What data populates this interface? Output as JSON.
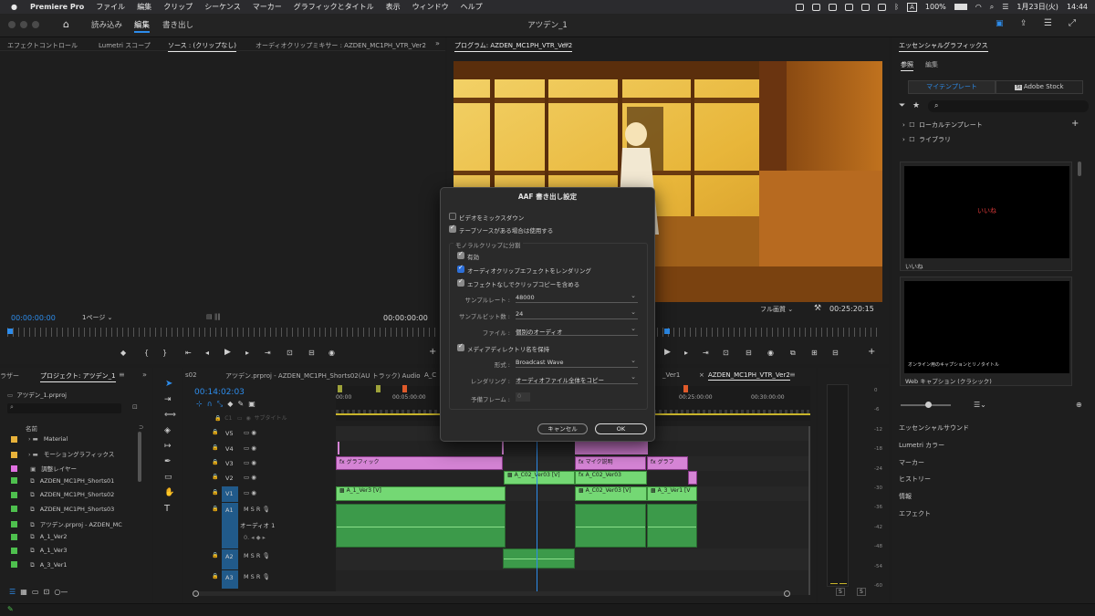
{
  "menubar": {
    "items": [
      "Premiere Pro",
      "ファイル",
      "編集",
      "クリップ",
      "シーケンス",
      "マーカー",
      "グラフィックとタイトル",
      "表示",
      "ウィンドウ",
      "ヘルプ"
    ],
    "battery": "100%",
    "input": "A",
    "datetime": "1月23日(火)",
    "time": "14:44"
  },
  "titlebar": {
    "workspaces": [
      "読み込み",
      "編集",
      "書き出し"
    ],
    "title": "アツデン_1"
  },
  "source_panel": {
    "tabs": [
      "エフェクトコントロール",
      "Lumetri スコープ",
      "ソース : (クリップなし)",
      "オーディオクリップミキサー : AZDEN_MC1PH_VTR_Ver2"
    ],
    "timecode_in": "00:00:00:00",
    "page": "1ページ",
    "timecode_out": "00:00:00:00"
  },
  "program_panel": {
    "title": "プログラム: AZDEN_MC1PH_VTR_Ver2",
    "quality": "フル画質",
    "timecode": "00:25:20:15"
  },
  "dialog": {
    "title": "AAF 書き出し設定",
    "mixdown": "ビデオをミックスダウン",
    "use_tape": "テープソースがある場合は使用する",
    "mono_group": "モノラルクリップに分割",
    "enable": "有効",
    "render_fx": "オーディオクリップエフェクトをレンダリング",
    "include_copy": "エフェクトなしでクリップコピーを含める",
    "sample_rate_label": "サンプルレート :",
    "sample_rate": "48000",
    "bit_depth_label": "サンプルビット数 :",
    "bit_depth": "24",
    "file_label": "ファイル :",
    "file": "個別のオーディオ",
    "keep_names": "メディアディレクトリ名を保持",
    "format_label": "形式 :",
    "format": "Broadcast Wave",
    "rendering_label": "レンダリング :",
    "rendering": "オーディオファイル全体をコピー",
    "preroll_label": "予備フレーム :",
    "preroll": "0",
    "cancel": "キャンセル",
    "ok": "OK"
  },
  "project_panel": {
    "tab_prev": "ラザー",
    "tab": "プロジェクト: アツデン_1",
    "file": "アツデン_1.prproj",
    "name_header": "名前",
    "items": [
      {
        "label": "Material",
        "color": "#e8b23a",
        "type": "folder"
      },
      {
        "label": "モーショングラフィックス",
        "color": "#e8b23a",
        "type": "folder"
      },
      {
        "label": "調整レイヤー",
        "color": "#e070e0",
        "type": "item"
      },
      {
        "label": "AZDEN_MC1PH_Shorts01",
        "color": "#4ec04e",
        "type": "seq"
      },
      {
        "label": "AZDEN_MC1PH_Shorts02",
        "color": "#4ec04e",
        "type": "seq"
      },
      {
        "label": "AZDEN_MC1PH_Shorts03",
        "color": "#4ec04e",
        "type": "seq"
      },
      {
        "label": "アツデン.prproj - AZDEN_MC",
        "color": "#4ec04e",
        "type": "seq"
      },
      {
        "label": "A_1_Ver2",
        "color": "#4ec04e",
        "type": "seq"
      },
      {
        "label": "A_1_Ver3",
        "color": "#4ec04e",
        "type": "seq"
      },
      {
        "label": "A_3_Ver1",
        "color": "#4ec04e",
        "type": "seq"
      }
    ]
  },
  "timeline": {
    "tabs": [
      "s02",
      "アツデン.prproj - AZDEN_MC1PH_Shorts02(AU トラック) Audio",
      "A_C",
      "_Ver1",
      "AZDEN_MC1PH_VTR_Ver2"
    ],
    "timecode": "00:14:02:03",
    "subtitle": "サブタイトル",
    "ruler": [
      "00:00",
      "00:05:00:00",
      "00:25:00:00",
      "00:30:00:00"
    ],
    "tracks_v": [
      "V5",
      "V4",
      "V3",
      "V2",
      "V1"
    ],
    "tracks_a": [
      "A1",
      "A2",
      "A3"
    ],
    "audio1_name": "オーディオ 1",
    "clips": {
      "graphic1": "グラフィック",
      "mic": "マイク説明",
      "graphic2": "グラフ",
      "ac02_v2a": "A_C02_Ver03 [V]",
      "ac02_v2b": "A_C02_Ver03",
      "a1": "A_1_Ver3 [V]",
      "ac02_v1": "A_C02_Ver03 [V]",
      "a3": "A_3_Ver1 [V"
    },
    "meter_ticks": [
      "0",
      "-6",
      "-12",
      "-18",
      "-24",
      "-30",
      "-36",
      "-42",
      "-48",
      "-54",
      "-60"
    ],
    "solo": [
      "S",
      "S"
    ]
  },
  "essential_graphics": {
    "title": "エッセンシャルグラフィックス",
    "tabs": [
      "参照",
      "編集"
    ],
    "my_templates": "マイテンプレート",
    "adobe_stock": "Adobe Stock",
    "tree": [
      "ローカルテンプレート",
      "ライブラリ"
    ],
    "thumb1_text": "いいね",
    "thumb1_label": "いいね",
    "thumb2_text": "オンライン用のキャプションとリノタイトル",
    "thumb2_label": "Web キャプション (クラシック)",
    "sections": [
      "エッセンシャルサウンド",
      "Lumetri カラー",
      "マーカー",
      "ヒストリー",
      "情報",
      "エフェクト"
    ]
  }
}
